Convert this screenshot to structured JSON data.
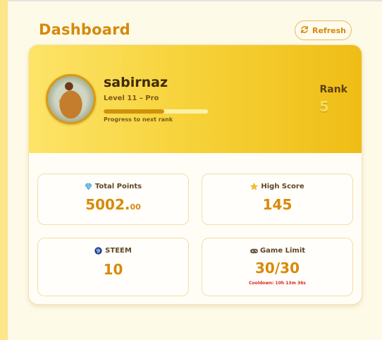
{
  "header": {
    "title": "Dashboard",
    "refresh_label": "Refresh"
  },
  "profile": {
    "username": "sabirnaz",
    "level": "Level 11 – Pro",
    "progress_fraction": 0.58,
    "progress_label": "Progress to next rank",
    "rank_label": "Rank",
    "rank_value": "5"
  },
  "stats": {
    "total_points": {
      "label": "Total Points",
      "value_int": "5002.",
      "value_dec": "00",
      "icon": "gem-icon"
    },
    "high_score": {
      "label": "High Score",
      "value": "145",
      "icon": "star-icon"
    },
    "steem": {
      "label": "STEEM",
      "value": "10",
      "icon": "steem-logo-icon"
    },
    "game_limit": {
      "label": "Game Limit",
      "value": "30/30",
      "cooldown": "Cooldown: 10h 13m 36s",
      "icon": "gamepad-icon"
    }
  },
  "colors": {
    "accent": "#d58a0c",
    "cooldown": "#e02222",
    "hero_start": "#fde469",
    "hero_end": "#efbd15"
  }
}
